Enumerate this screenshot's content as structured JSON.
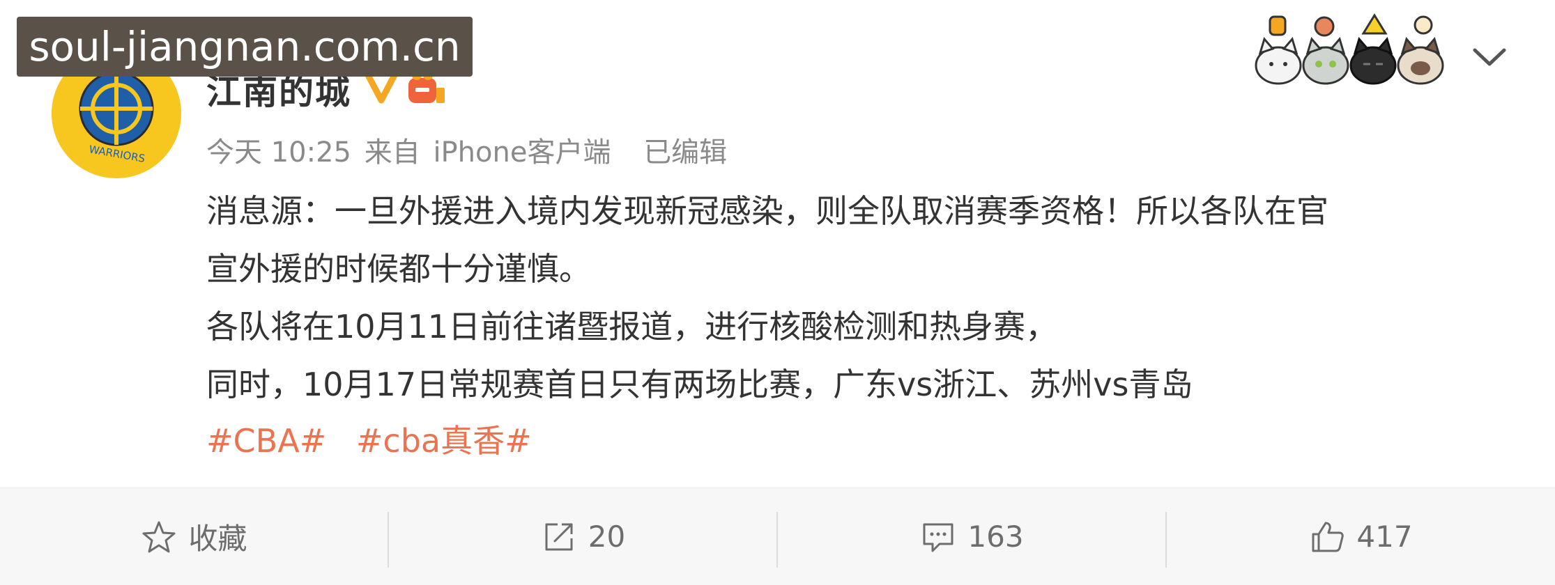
{
  "watermark": "soul-jiangnan.com.cn",
  "author": {
    "name": "江南的城",
    "avatar_text": "WARRIORS",
    "verified_icon": "verified-v-icon",
    "member_icon": "vip-crown-icon"
  },
  "post": {
    "time": "今天 10:25",
    "source_prefix": "来自",
    "source": "iPhone客户端",
    "edited": "已编辑",
    "lines": [
      "消息源：一旦外援进入境内发现新冠感染，则全队取消赛季资格！所以各队在官",
      "宣外援的时候都十分谨慎。",
      "各队将在10月11日前往诸暨报道，进行核酸检测和热身赛，",
      "同时，10月17日常规赛首日只有两场比赛，广东vs浙江、苏州vs青岛"
    ],
    "tags": [
      "#CBA#",
      "#cba真香#"
    ]
  },
  "actions": {
    "favorite": {
      "label": "收藏",
      "icon": "star-icon"
    },
    "repost": {
      "count": "20",
      "icon": "repost-icon"
    },
    "comment": {
      "count": "163",
      "icon": "comment-icon"
    },
    "like": {
      "count": "417",
      "icon": "thumbs-up-icon"
    }
  },
  "colors": {
    "accent_tag": "#eb7350",
    "verified": "#f5a623",
    "muted_text": "#8a8a8a",
    "action_bar_bg": "#f7f7f7"
  }
}
